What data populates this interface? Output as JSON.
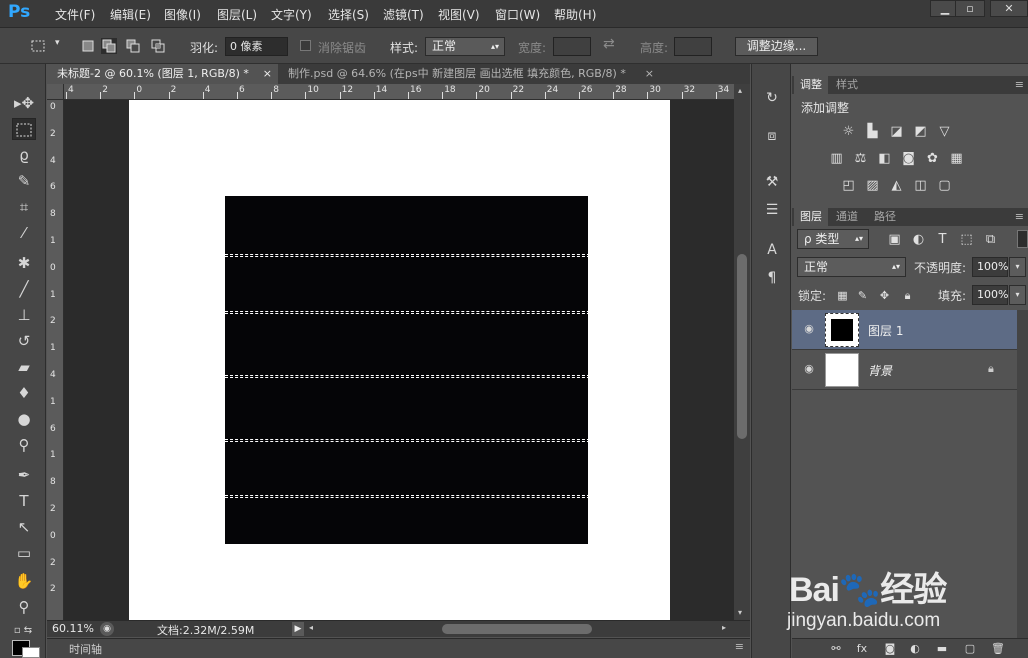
{
  "app": {
    "logo": "Ps"
  },
  "menu": [
    "文件(F)",
    "编辑(E)",
    "图像(I)",
    "图层(L)",
    "文字(Y)",
    "选择(S)",
    "滤镜(T)",
    "视图(V)",
    "窗口(W)",
    "帮助(H)"
  ],
  "window_controls": {
    "minimize": "▁",
    "maximize": "▫",
    "close": "✕"
  },
  "options": {
    "feather_label": "羽化:",
    "feather_value": "0 像素",
    "antialias_label": "消除锯齿",
    "style_label": "样式:",
    "style_value": "正常",
    "width_label": "宽度:",
    "height_label": "高度:",
    "refine_button": "调整边缘..."
  },
  "tabs": [
    {
      "label": "未标题-2 @ 60.1% (图层 1, RGB/8) *",
      "close": "×"
    },
    {
      "label": "制作.psd @ 64.6% (在ps中 新建图层 画出选框 填充颜色, RGB/8) *",
      "close": "×"
    }
  ],
  "ruler_h": [
    "4",
    "2",
    "0",
    "2",
    "4",
    "6",
    "8",
    "10",
    "12",
    "14",
    "16",
    "18",
    "20",
    "22",
    "24",
    "26",
    "28",
    "30",
    "32",
    "34"
  ],
  "ruler_v": [
    "0",
    "2",
    "4",
    "6",
    "8",
    "1",
    "0",
    "1",
    "2",
    "1",
    "4",
    "1",
    "6",
    "1",
    "8",
    "2",
    "0",
    "2",
    "2"
  ],
  "status": {
    "zoom": "60.11%",
    "doc": "文档:2.32M/2.59M"
  },
  "timeline": {
    "label": "时间轴"
  },
  "panels": {
    "adjust_tab": "调整",
    "style_tab": "样式",
    "add_adjust": "添加调整",
    "layers_tab": "图层",
    "channels_tab": "通道",
    "paths_tab": "路径",
    "kind_filter": "ρ 类型",
    "blend_mode": "正常",
    "opacity_label": "不透明度:",
    "opacity_value": "100%",
    "lock_label": "锁定:",
    "fill_label": "填充:",
    "fill_value": "100%",
    "layers": [
      {
        "name": "图层 1",
        "selected": true
      },
      {
        "name": "背景",
        "locked": true
      }
    ]
  },
  "watermark": {
    "logo": "Bai🐾经验",
    "url": "jingyan.baidu.com"
  },
  "colors": {
    "accent": "#31a8ff",
    "selected_layer": "#5d6b85",
    "canvas_bg": "#2b2b2b"
  }
}
